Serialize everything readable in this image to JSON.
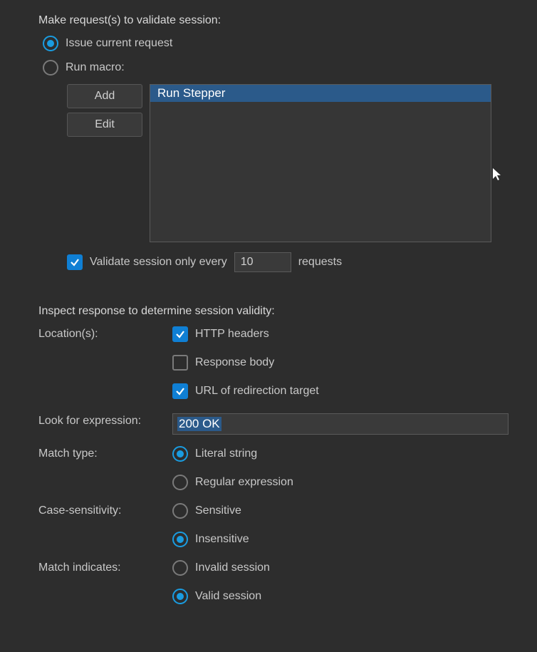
{
  "validate": {
    "title": "Make request(s) to validate session:",
    "issue_current": "Issue current request",
    "run_macro": "Run macro:",
    "selected": "issue_current",
    "buttons": {
      "add": "Add",
      "edit": "Edit"
    },
    "macro_items": [
      "Run Stepper"
    ],
    "macro_selected_index": 0,
    "every": {
      "checked": true,
      "prefix": "Validate session only every",
      "value": "10",
      "suffix": "requests"
    }
  },
  "inspect": {
    "title": "Inspect response to determine session validity:",
    "locations_label": "Location(s):",
    "locations": [
      {
        "label": "HTTP headers",
        "checked": true
      },
      {
        "label": "Response body",
        "checked": false
      },
      {
        "label": "URL of redirection target",
        "checked": true
      }
    ],
    "expression_label": "Look for expression:",
    "expression_value": "200 OK",
    "match_type_label": "Match type:",
    "match_type": {
      "options": [
        "Literal string",
        "Regular expression"
      ],
      "selected": 0
    },
    "case_label": "Case-sensitivity:",
    "case": {
      "options": [
        "Sensitive",
        "Insensitive"
      ],
      "selected": 1
    },
    "indicates_label": "Match indicates:",
    "indicates": {
      "options": [
        "Invalid session",
        "Valid session"
      ],
      "selected": 1
    }
  }
}
